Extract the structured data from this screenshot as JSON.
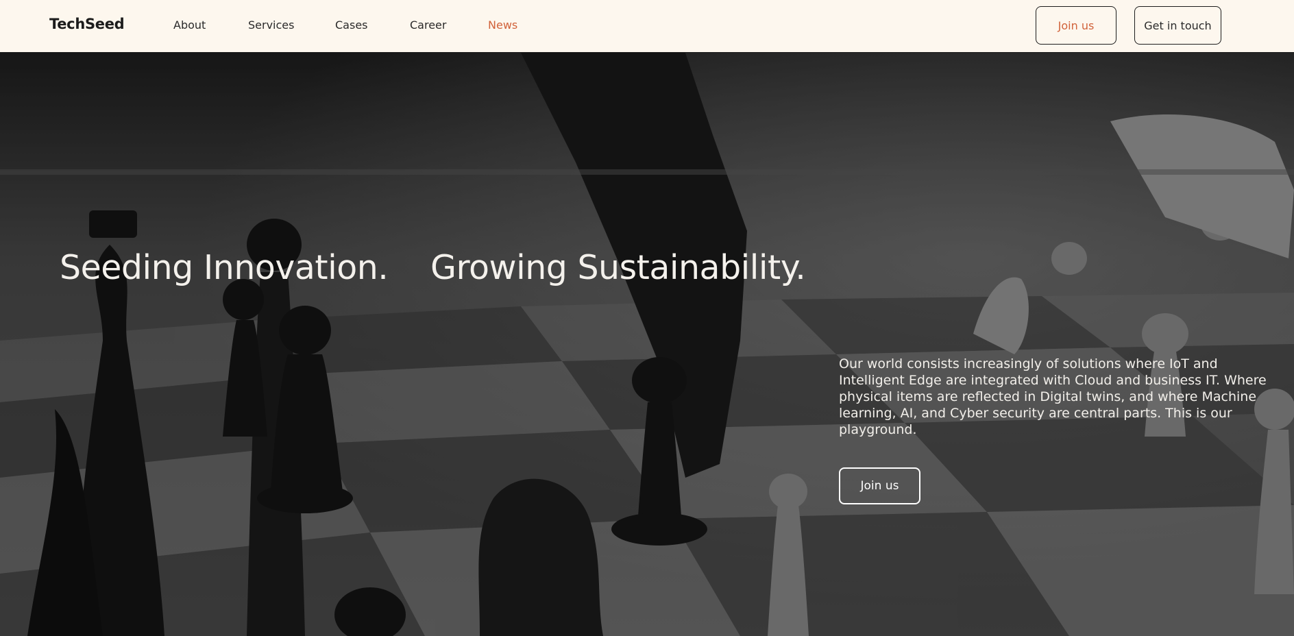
{
  "brand": "TechSeed",
  "nav": {
    "items": [
      {
        "label": "About"
      },
      {
        "label": "Services"
      },
      {
        "label": "Cases"
      },
      {
        "label": "Career"
      },
      {
        "label": "News"
      }
    ],
    "active": "News",
    "join_label": "Join us",
    "contact_label": "Get in touch"
  },
  "hero": {
    "headline_1": "Seeding Innovation.",
    "headline_2": "Growing Sustainability.",
    "description": "Our world consists increasingly of solutions where IoT and Intelligent Edge are integrated with Cloud and business IT. Where physical items are reflected in Digital twins, and where Machine learning, AI, and Cyber security are central parts. This is our playground.",
    "cta_label": "Join us",
    "background_image": "chess-board-photo"
  },
  "colors": {
    "nav_background": "#fdf7ee",
    "accent": "#d1623a",
    "text_dark": "#1c1c1c",
    "hero_text": "#f4f1ec"
  }
}
